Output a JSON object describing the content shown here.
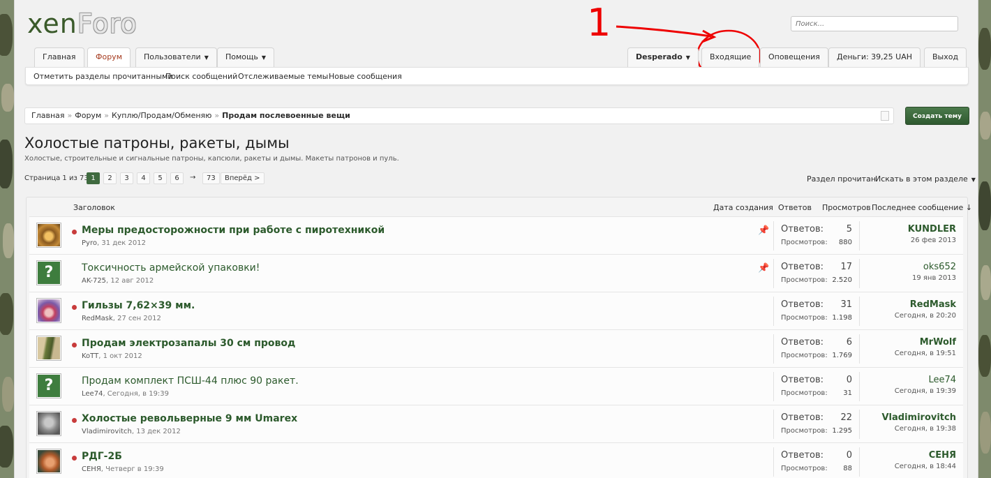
{
  "logo": {
    "part1": "xen",
    "part2": "Foro"
  },
  "search": {
    "placeholder": "Поиск..."
  },
  "nav": {
    "home": "Главная",
    "forum": "Форум",
    "users": "Пользователи",
    "help": "Помощь",
    "user": "Desperado",
    "inbox": "Входящие",
    "alerts": "Оповещения",
    "money": "Деньги: 39,25 UAH",
    "logout": "Выход"
  },
  "subnav": {
    "mark_read": "Отметить разделы прочитанными",
    "search_posts": "Поиск сообщений",
    "watched": "Отслеживаемые темы",
    "new_posts": "Новые сообщения"
  },
  "annotation": {
    "number": "1"
  },
  "breadcrumb": {
    "items": [
      "Главная",
      "Форум",
      "Куплю/Продам/Обменяю"
    ],
    "current": "Продам послевоенные вещи",
    "separator": "»"
  },
  "create_button": "Создать тему",
  "page_title": "Холостые патроны, ракеты, дымы",
  "page_description": "Холостые, строительные и сигнальные патроны, капсюли, ракеты и дымы. Макеты патронов и пуль.",
  "pagination": {
    "label": "Страница 1 из 73",
    "pages": [
      "1",
      "2",
      "3",
      "4",
      "5",
      "6"
    ],
    "ellipsis": "→",
    "last": "73",
    "next": "Вперёд >"
  },
  "actions": {
    "mark_read": "Раздел прочитан",
    "search_section": "Искать в этом разделе"
  },
  "columns": {
    "title": "Заголовок",
    "created": "Дата создания",
    "replies": "Ответов",
    "views": "Просмотров",
    "last": "Последнее сообщение ↓"
  },
  "labels": {
    "replies": "Ответов:",
    "views": "Просмотров:"
  },
  "threads": [
    {
      "title": "Меры предосторожности при работе с пиротехникой",
      "author": "Pyro",
      "date": "31 дек 2012",
      "replies": "5",
      "views": "880",
      "last_user": "KUNDLER",
      "last_date": "26 фев 2013"
    },
    {
      "title": "Токсичность армейской упаковки!",
      "author": "AK-725",
      "date": "12 авг 2012",
      "replies": "17",
      "views": "2.520",
      "last_user": "oks652",
      "last_date": "19 янв 2013"
    },
    {
      "title": "Гильзы 7,62×39 мм.",
      "author": "RedMask",
      "date": "27 сен 2012",
      "replies": "31",
      "views": "1.198",
      "last_user": "RedMask",
      "last_date": "Сегодня, в 20:20"
    },
    {
      "title": "Продам электрозапалы 30 см провод",
      "author": "KoTT",
      "date": "1 окт 2012",
      "replies": "6",
      "views": "1.769",
      "last_user": "MrWolf",
      "last_date": "Сегодня, в 19:51"
    },
    {
      "title": "Продам комплект ПСШ-44 плюс 90 ракет.",
      "author": "Lee74",
      "date": "Сегодня, в 19:39",
      "replies": "0",
      "views": "31",
      "last_user": "Lee74",
      "last_date": "Сегодня, в 19:39"
    },
    {
      "title": "Холостые револьверные 9 мм Umarex",
      "author": "Vladimirovitch",
      "date": "13 дек 2012",
      "replies": "22",
      "views": "1.295",
      "last_user": "Vladimirovitch",
      "last_date": "Сегодня, в 19:38"
    },
    {
      "title": "РДГ-2Б",
      "author": "СЕНЯ",
      "date": "Четверг в 19:39",
      "replies": "0",
      "views": "88",
      "last_user": "СЕНЯ",
      "last_date": "Сегодня, в 18:44"
    }
  ]
}
